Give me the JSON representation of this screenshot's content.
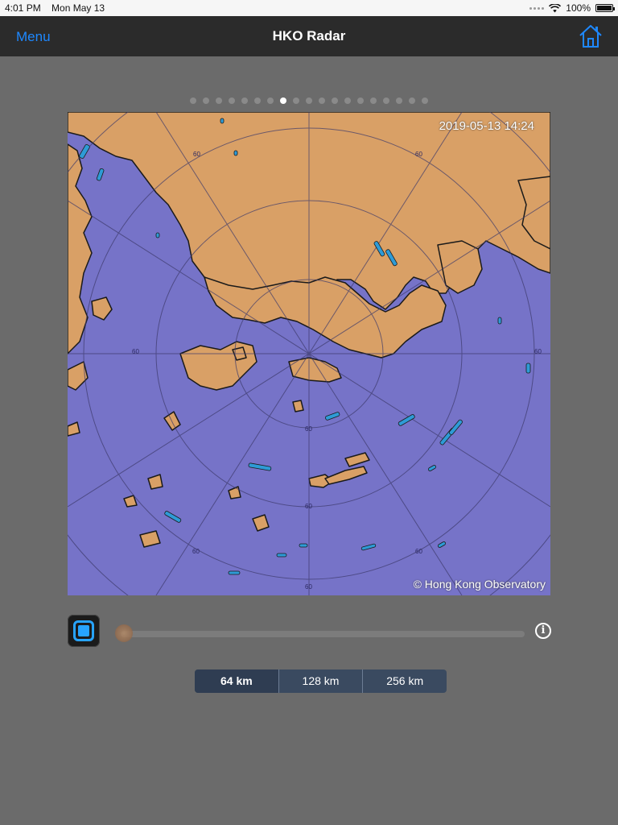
{
  "status_bar": {
    "time": "4:01 PM",
    "date": "Mon May 13",
    "battery": "100%"
  },
  "nav": {
    "menu_label": "Menu",
    "title": "HKO Radar",
    "home_icon": "home-icon"
  },
  "pager": {
    "total": 19,
    "active_index": 7
  },
  "radar": {
    "timestamp": "2019-05-13 14:24",
    "copyright": "© Hong Kong Observatory",
    "colors": {
      "sea": "#7673c8",
      "land": "#d9a066",
      "echo": "#2e9bd6"
    }
  },
  "controls": {
    "stop_icon": "stop-icon",
    "info_icon": "info-icon",
    "slider_position": 0.0
  },
  "range_options": [
    "64 km",
    "128 km",
    "256 km"
  ],
  "range_selected": "64 km"
}
